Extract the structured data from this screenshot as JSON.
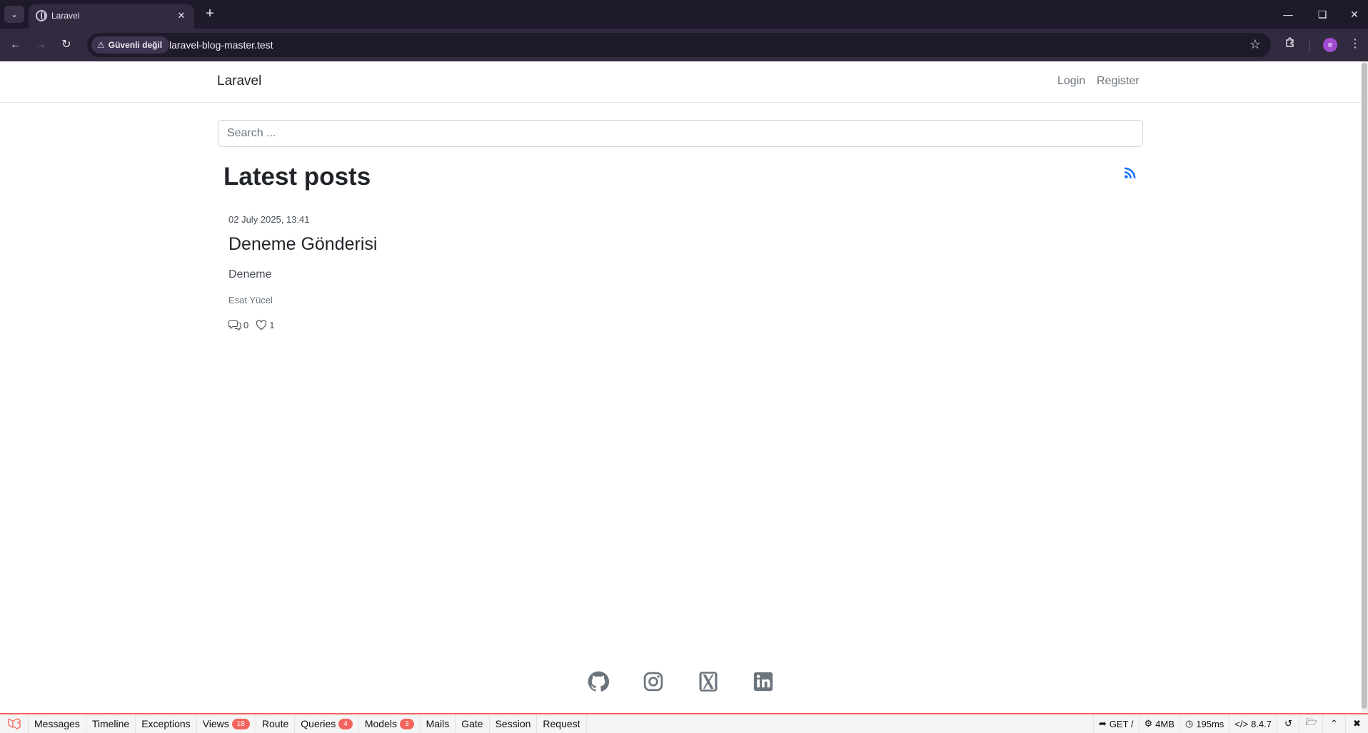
{
  "browser": {
    "tab_title": "Laravel",
    "security_label": "Güvenli değil",
    "url": "laravel-blog-master.test",
    "profile_initial": "e"
  },
  "navbar": {
    "brand": "Laravel",
    "login": "Login",
    "register": "Register"
  },
  "search": {
    "placeholder": "Search ..."
  },
  "main": {
    "title": "Latest posts",
    "posts": [
      {
        "date": "02 July 2025, 13:41",
        "title": "Deneme Gönderisi",
        "excerpt": "Deneme",
        "author": "Esat Yücel",
        "comments": "0",
        "likes": "1"
      }
    ]
  },
  "footer": {
    "icons": [
      "github-icon",
      "instagram-icon",
      "x-twitter-icon",
      "linkedin-icon"
    ]
  },
  "debugbar": {
    "tabs": {
      "messages": "Messages",
      "timeline": "Timeline",
      "exceptions": "Exceptions",
      "views": "Views",
      "views_count": "18",
      "route": "Route",
      "queries": "Queries",
      "queries_count": "4",
      "models": "Models",
      "models_count": "3",
      "mails": "Mails",
      "gate": "Gate",
      "session": "Session",
      "request": "Request"
    },
    "indicators": {
      "route": "GET /",
      "memory": "4MB",
      "time": "195ms",
      "php_version": "8.4.7"
    }
  },
  "colors": {
    "browser_frame": "#1f1a2b",
    "browser_toolbar": "#322b3f",
    "link_primary": "#0d6efd",
    "debugbar_accent": "#f4645f",
    "profile_avatar": "#a24bd1"
  }
}
